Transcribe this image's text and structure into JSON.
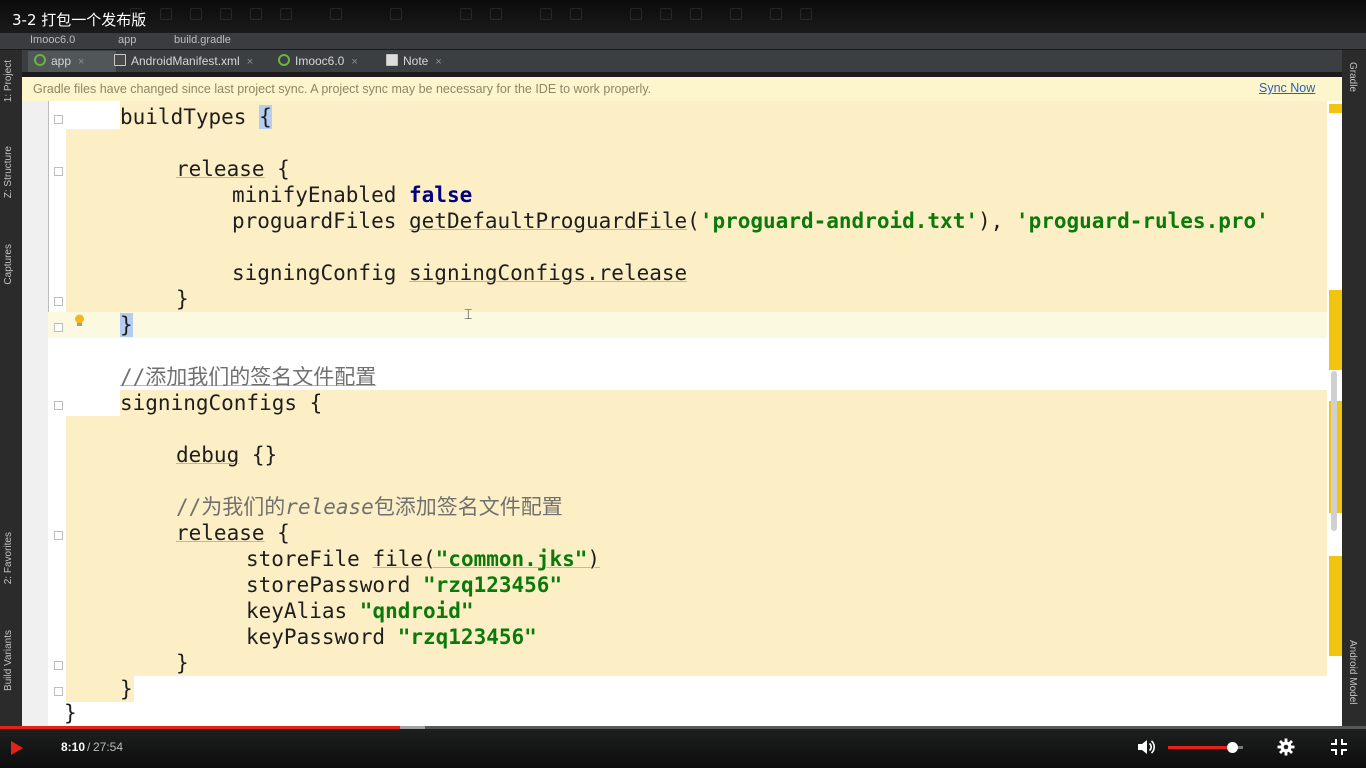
{
  "video": {
    "title": "3-2 打包一个发布版",
    "time_current": "8:10",
    "time_separator": "/",
    "time_total": "27:54",
    "played_fraction": 0.293,
    "volume_fraction": 0.85
  },
  "breadcrumb": [
    "Imooc6.0",
    "app",
    "build.gradle"
  ],
  "tabs": [
    {
      "label": "app",
      "active": true,
      "icon": "gradle-icon"
    },
    {
      "label": "AndroidManifest.xml",
      "active": false,
      "icon": "xml-file-icon"
    },
    {
      "label": "Imooc6.0",
      "active": false,
      "icon": "gradle-icon"
    },
    {
      "label": "Note",
      "active": false,
      "icon": "note-icon"
    }
  ],
  "tab_close_glyph": "×",
  "left_tools": [
    "1: Project",
    "Z: Structure",
    "Captures",
    "2: Favorites",
    "Build Variants"
  ],
  "right_tools": [
    "Gradle",
    "Android Model"
  ],
  "banner": {
    "message": "Gradle files have changed since last project sync. A project sync may be necessary for the IDE to work properly.",
    "action": "Sync Now"
  },
  "code": {
    "l1": "buildTypes ",
    "l1_brace": "{",
    "l2_kw": "release",
    "l2_rest": " {",
    "l3_name": "minifyEnabled ",
    "l3_val": "false",
    "l4_name": "proguardFiles ",
    "l4_fn": "getDefaultProguardFile",
    "l4_open": "(",
    "l4_arg1": "'proguard-android.txt'",
    "l4_mid": "), ",
    "l4_arg2": "'proguard-rules.pro'",
    "l5_name": "signingConfig ",
    "l5_val": "signingConfigs.release",
    "l6": "}",
    "l7": "}",
    "l8_comment": "//添加我们的签名文件配置",
    "l9": "signingConfigs {",
    "l10_kw": "debug",
    "l10_rest": " {}",
    "l11_a": "//为我们的",
    "l11_b": "release",
    "l11_c": "包添加签名文件配置",
    "l12_kw": "release",
    "l12_rest": " {",
    "l13_name": "storeFile ",
    "l13_fn": "file(",
    "l13_str": "\"common.jks\"",
    "l13_close": ")",
    "l14_name": "storePassword ",
    "l14_str": "\"rzq123456\"",
    "l15_name": "keyAlias ",
    "l15_str": "\"qndroid\"",
    "l16_name": "keyPassword ",
    "l16_str": "\"rzq123456\"",
    "l17": "}",
    "l18": "}",
    "l19": "}"
  }
}
